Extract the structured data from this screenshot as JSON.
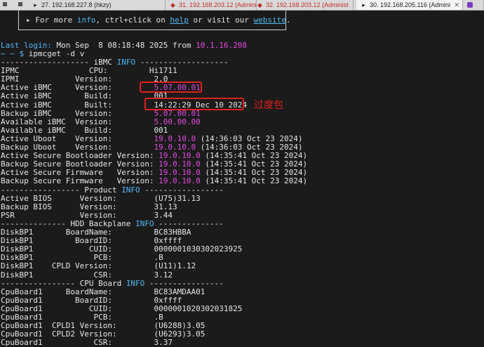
{
  "tabs": [
    {
      "label": "27. 192.168.227.8 (hkzy)",
      "icon": "terminal-icon"
    },
    {
      "label": "31. 192.168.203.12 (Administ",
      "icon": "warning-icon"
    },
    {
      "label": "32. 192.168.203.12 (Administ",
      "icon": "warning-icon"
    },
    {
      "label": "30. 192.168.205.116 (Admini",
      "icon": "terminal-icon",
      "active": true
    },
    {
      "label": "",
      "icon": "app-icon"
    }
  ],
  "banner": {
    "prefix": "▸ For more ",
    "info": "info",
    "mid": ", ctrl+click on ",
    "help": "help",
    "mid2": " or visit our ",
    "website": "website",
    "suffix": "."
  },
  "login": {
    "prefix": "Last login: ",
    "date": "Mon Sep  8 08:18:48 2025 from ",
    "ip": "10.1.16.208"
  },
  "prompt": {
    "symbol": "~ ~ $ ",
    "command": "ipmcget -d v"
  },
  "rows": [
    {
      "a": "------------------- iBMC ",
      "b": "INFO",
      "c": " -------------------"
    },
    {
      "a": "IPMC               CPU:         ",
      "v": "Hi1711"
    },
    {
      "a": "IPMI            Version:         ",
      "v": "2.0"
    },
    {
      "a": "Active iBMC     Version:         ",
      "m": "5.07.00.01"
    },
    {
      "a": "Active iBMC       Build:         ",
      "v": "001"
    },
    {
      "a": "Active iBMC       Built:         ",
      "v": "14:22:29 Dec 10 2024"
    },
    {
      "a": "Backup iBMC     Version:         ",
      "m": "5.07.00.01"
    },
    {
      "a": "Available iBMC  Version:         ",
      "m": "5.00.00.00"
    },
    {
      "a": "Available iBMC    Build:         ",
      "v": "001"
    },
    {
      "a": "Active Uboot    Version:         ",
      "m": "19.0.10.0",
      "t": " (14:36:03 Oct 23 2024)"
    },
    {
      "a": "Backup Uboot    Version:         ",
      "m": "19.0.10.0",
      "t": " (14:36:03 Oct 23 2024)"
    },
    {
      "a": "Active Secure Bootloader Version: ",
      "m": "19.0.10.0",
      "t": " (14:35:41 Oct 23 2024)"
    },
    {
      "a": "Backup Secure Bootloader Version: ",
      "m": "19.0.10.0",
      "t": " (14:35:41 Oct 23 2024)"
    },
    {
      "a": "Active Secure Firmware   Version: ",
      "m": "19.0.10.0",
      "t": " (14:35:41 Oct 23 2024)"
    },
    {
      "a": "Backup Secure Firmware   Version: ",
      "m": "19.0.10.0",
      "t": " (14:35:41 Oct 23 2024)"
    },
    {
      "a": "----------------- Product ",
      "b": "INFO",
      "c": " -----------------"
    },
    {
      "a": "Active BIOS      Version:        ",
      "v": "(U75)31.13"
    },
    {
      "a": "Backup BIOS      Version:        ",
      "v": "31.13"
    },
    {
      "a": "PSR              Version:        ",
      "v": "3.44"
    },
    {
      "a": "-------------- HDD Backplane ",
      "b": "INFO",
      "c": " --------------"
    },
    {
      "a": "DiskBP1       BoardName:         ",
      "v": "BC83HBBA"
    },
    {
      "a": "DiskBP1         BoardID:         ",
      "v": "0xffff"
    },
    {
      "a": "DiskBP1            CUID:         ",
      "v": "0000001030302023925"
    },
    {
      "a": "DiskBP1             PCB:         ",
      "v": ".B"
    },
    {
      "a": "DiskBP1    CPLD Version:         ",
      "v": "(U11)1.12"
    },
    {
      "a": "DiskBP1             CSR:         ",
      "v": "3.12"
    },
    {
      "a": "---------------- CPU Board ",
      "b": "INFO",
      "c": " ----------------"
    },
    {
      "a": "CpuBoard1     BoardName:         ",
      "v": "BC83AMDAA01"
    },
    {
      "a": "CpuBoard1       BoardID:         ",
      "v": "0xffff"
    },
    {
      "a": "CpuBoard1          CUID:         ",
      "v": "0000001020302031825"
    },
    {
      "a": "CpuBoard1           PCB:         ",
      "v": ".B"
    },
    {
      "a": "CpuBoard1  CPLD1 Version:        ",
      "v": "(U6288)3.05"
    },
    {
      "a": "CpuBoard1  CPLD2 Version:        ",
      "v": "(U6293)3.05"
    },
    {
      "a": "CpuBoard1           CSR:         ",
      "v": "3.37"
    }
  ],
  "annotation": "过度包",
  "colors": {
    "background": "#1b1b1b",
    "cyan": "#52b8f0",
    "magenta": "#e24ae2",
    "highlight": "#e0201e"
  }
}
